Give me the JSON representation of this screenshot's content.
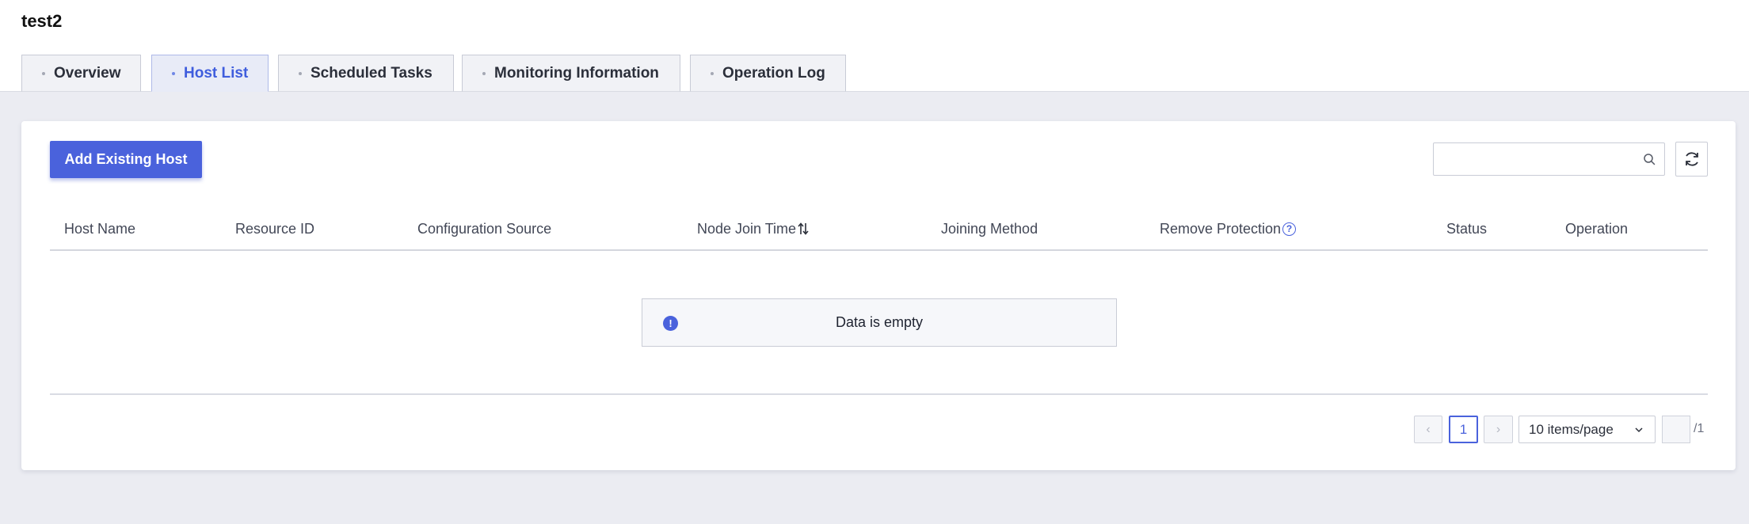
{
  "page": {
    "title": "test2"
  },
  "tabs": [
    {
      "label": "Overview",
      "active": false
    },
    {
      "label": "Host List",
      "active": true
    },
    {
      "label": "Scheduled Tasks",
      "active": false
    },
    {
      "label": "Monitoring Information",
      "active": false
    },
    {
      "label": "Operation Log",
      "active": false
    }
  ],
  "toolbar": {
    "add_button_label": "Add Existing Host",
    "search_placeholder": "",
    "search_icon": "search-icon",
    "refresh_icon": "refresh-icon"
  },
  "table": {
    "columns": [
      "Host Name",
      "Resource ID",
      "Configuration Source",
      "Node Join Time",
      "Joining Method",
      "Remove Protection",
      "Status",
      "Operation"
    ],
    "rows": [],
    "empty_text": "Data is empty",
    "help_glyph": "?",
    "info_glyph": "!"
  },
  "pagination": {
    "prev": "‹",
    "current_page": "1",
    "next": "›",
    "page_size": "10 items/page",
    "jump_value": "",
    "total_pages": "/1"
  },
  "colors": {
    "accent": "#4a62dc",
    "background": "#ebecf2"
  }
}
